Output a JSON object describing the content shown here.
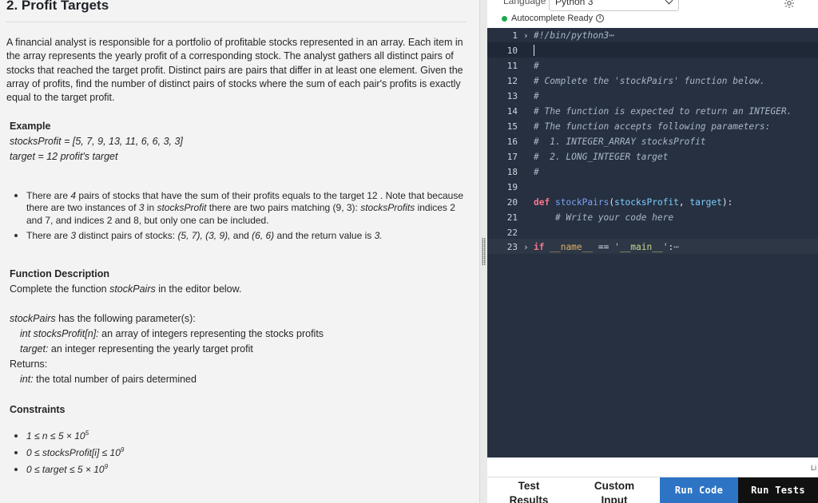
{
  "problem": {
    "title": "2. Profit Targets",
    "description": "A financial analyst is responsible for a portfolio of profitable stocks represented in an array. Each item in the array represents the yearly profit of a corresponding stock. The analyst gathers all distinct pairs of stocks that reached the target profit. Distinct pairs are pairs that differ in at least one element. Given the array of profits, find the number of distinct pairs of stocks where the sum of each pair's profits is exactly equal to the target profit.",
    "example_heading": "Example",
    "example_line1": "stocksProfit = [5, 7, 9, 13, 11, 6, 6, 3, 3]",
    "example_line2": "target = 12 profit's target",
    "bullet1_a": "There are ",
    "bullet1_count": "4",
    "bullet1_b": " pairs of stocks that have the sum of their profits equals to the target 12 . Note that because there are two instances of ",
    "bullet1_count2": "3",
    "bullet1_c": " in ",
    "bullet1_var": "stocksProfit",
    "bullet1_d": " there are two pairs matching (9, 3): ",
    "bullet1_var2": "stocksProfits",
    "bullet1_e": " indices 2 and 7, and indices 2 and 8, but only one can be included.",
    "bullet2_a": "There are ",
    "bullet2_count": "3",
    "bullet2_b": " distinct pairs of stocks: ",
    "bullet2_pairs": "(5, 7), (3, 9),",
    "bullet2_c": " and ",
    "bullet2_pair3": "(6, 6)",
    "bullet2_d": " and the return value is ",
    "bullet2_ret": "3.",
    "func_heading": "Function Description",
    "func_a": "Complete the function ",
    "func_name": "stockPairs",
    "func_b": " in the editor below.",
    "params_name": "stockPairs",
    "params_text": " has the following parameter(s):",
    "param1_sig": "int stocksProfit[n]:",
    "param1_desc": " an array of integers representing the stocks profits",
    "param2_sig": "target:",
    "param2_desc": " an integer representing the yearly target profit",
    "returns_label": "Returns:",
    "returns_sig": "int:",
    "returns_desc": " the total number of pairs determined",
    "constraints_heading": "Constraints",
    "c1_a": "1 ≤ n ≤ 5 × 10",
    "c1_sup": "5",
    "c2_a": "0 ≤ stocksProfit[i] ≤ 10",
    "c2_sup": "9",
    "c3_a": "0 ≤  target ≤ 5 × 10",
    "c3_sup": "9"
  },
  "editor": {
    "language_label": "Language",
    "language_value": "Python 3",
    "autocomplete": "Autocomplete Ready",
    "lines": [
      {
        "n": "1",
        "text": "#!/bin/python3"
      },
      {
        "n": "10",
        "text": ""
      },
      {
        "n": "11",
        "text": "#"
      },
      {
        "n": "12",
        "text": "# Complete the 'stockPairs' function below."
      },
      {
        "n": "13",
        "text": "#"
      },
      {
        "n": "14",
        "text": "# The function is expected to return an INTEGER."
      },
      {
        "n": "15",
        "text": "# The function accepts following parameters:"
      },
      {
        "n": "16",
        "text": "#  1. INTEGER_ARRAY stocksProfit"
      },
      {
        "n": "17",
        "text": "#  2. LONG_INTEGER target"
      },
      {
        "n": "18",
        "text": "#"
      },
      {
        "n": "19",
        "text": ""
      },
      {
        "n": "20",
        "text": ""
      },
      {
        "n": "21",
        "text": "    # Write your code here"
      },
      {
        "n": "22",
        "text": ""
      },
      {
        "n": "23",
        "text": ""
      }
    ],
    "def_kw": "def",
    "def_name": "stockPairs",
    "def_p1": "stocksProfit",
    "def_p2": "target",
    "if_kw": "if",
    "if_name": "__name__",
    "if_op": " == ",
    "if_str": "'__main__'",
    "if_end": ":",
    "ellipsis": "⋯",
    "status_right": "Li"
  },
  "bottom": {
    "tab1": "Test Results",
    "tab2": "Custom Input",
    "run_code": "Run Code",
    "run_tests": "Run Tests"
  }
}
